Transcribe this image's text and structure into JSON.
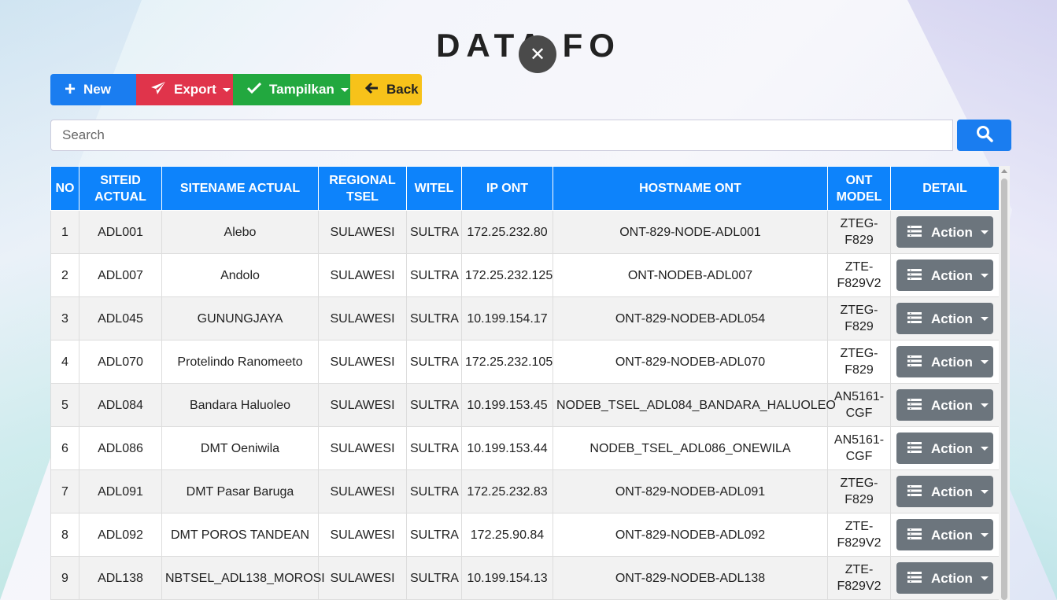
{
  "page": {
    "title": "DATA FO"
  },
  "toolbar": {
    "new_label": "New",
    "export_label": "Export",
    "tampilkan_label": "Tampilkan",
    "back_label": "Back"
  },
  "search": {
    "placeholder": "Search"
  },
  "table": {
    "headers": [
      "NO",
      "SITEID ACTUAL",
      "SITENAME ACTUAL",
      "REGIONAL TSEL",
      "WITEL",
      "IP ONT",
      "HOSTNAME ONT",
      "ONT MODEL",
      "DETAIL"
    ],
    "action_label": "Action",
    "rows": [
      [
        "1",
        "ADL001",
        "Alebo",
        "SULAWESI",
        "SULTRA",
        "172.25.232.80",
        "ONT-829-NODE-ADL001",
        "ZTEG-F829"
      ],
      [
        "2",
        "ADL007",
        "Andolo",
        "SULAWESI",
        "SULTRA",
        "172.25.232.125",
        "ONT-NODEB-ADL007",
        "ZTE-F829V2"
      ],
      [
        "3",
        "ADL045",
        "GUNUNGJAYA",
        "SULAWESI",
        "SULTRA",
        "10.199.154.17",
        "ONT-829-NODEB-ADL054",
        "ZTEG-F829"
      ],
      [
        "4",
        "ADL070",
        "Protelindo Ranomeeto",
        "SULAWESI",
        "SULTRA",
        "172.25.232.105",
        "ONT-829-NODEB-ADL070",
        "ZTEG-F829"
      ],
      [
        "5",
        "ADL084",
        "Bandara Haluoleo",
        "SULAWESI",
        "SULTRA",
        "10.199.153.45",
        "NODEB_TSEL_ADL084_BANDARA_HALUOLEO",
        "AN5161-CGF"
      ],
      [
        "6",
        "ADL086",
        "DMT Oeniwila",
        "SULAWESI",
        "SULTRA",
        "10.199.153.44",
        "NODEB_TSEL_ADL086_ONEWILA",
        "AN5161-CGF"
      ],
      [
        "7",
        "ADL091",
        "DMT Pasar Baruga",
        "SULAWESI",
        "SULTRA",
        "172.25.232.83",
        "ONT-829-NODEB-ADL091",
        "ZTEG-F829"
      ],
      [
        "8",
        "ADL092",
        "DMT POROS TANDEAN",
        "SULAWESI",
        "SULTRA",
        "172.25.90.84",
        "ONT-829-NODEB-ADL092",
        "ZTE-F829V2"
      ],
      [
        "9",
        "ADL138",
        "NBTSEL_ADL138_MOROSI",
        "SULAWESI",
        "SULTRA",
        "10.199.154.13",
        "ONT-829-NODEB-ADL138",
        "ZTE-F829V2"
      ]
    ]
  },
  "colors": {
    "primary": "#0d83fb",
    "danger": "#e0344b",
    "success": "#22a83f",
    "warning": "#f7c21a",
    "secondary": "#6c757d"
  }
}
